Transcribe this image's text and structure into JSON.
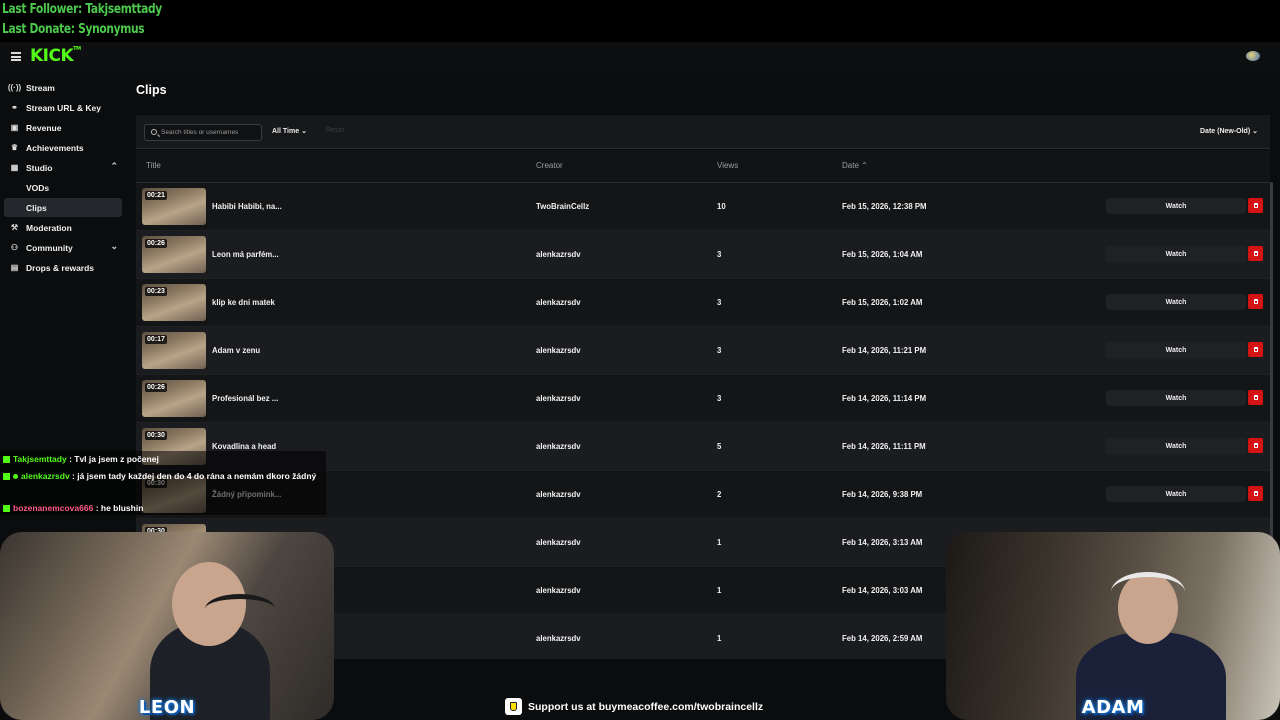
{
  "overlay": {
    "last_follower": "Last Follower: Takjsemttady",
    "last_donate": "Last Donate: Synonymus"
  },
  "header": {
    "logo": "KICK",
    "logo_tm": "TM"
  },
  "sidebar": {
    "items": [
      {
        "label": "Stream",
        "icon": "broadcast-icon"
      },
      {
        "label": "Stream URL & Key",
        "icon": "link-icon"
      },
      {
        "label": "Revenue",
        "icon": "wallet-icon"
      },
      {
        "label": "Achievements",
        "icon": "trophy-icon"
      },
      {
        "label": "Studio",
        "icon": "film-icon"
      },
      {
        "label": "VODs"
      },
      {
        "label": "Clips"
      },
      {
        "label": "Moderation",
        "icon": "hammer-icon"
      },
      {
        "label": "Community",
        "icon": "users-icon"
      },
      {
        "label": "Drops & rewards",
        "icon": "gift-icon"
      }
    ]
  },
  "page": {
    "title": "Clips"
  },
  "filters": {
    "search_placeholder": "Search titles or usernames",
    "time_range": "All Time",
    "reset": "Reset",
    "sort": "Date (New-Old)"
  },
  "table": {
    "columns": [
      "Title",
      "Creator",
      "Views",
      "Date"
    ],
    "watch_label": "Watch",
    "rows": [
      {
        "duration": "00:21",
        "title": "Habibi Habibi, na...",
        "creator": "TwoBrainCellz",
        "views": "10",
        "date": "Feb 15, 2026, 12:38 PM"
      },
      {
        "duration": "00:26",
        "title": "Leon má parfém...",
        "creator": "alenkazrsdv",
        "views": "3",
        "date": "Feb 15, 2026, 1:04 AM"
      },
      {
        "duration": "00:23",
        "title": "klip ke dni matek",
        "creator": "alenkazrsdv",
        "views": "3",
        "date": "Feb 15, 2026, 1:02 AM"
      },
      {
        "duration": "00:17",
        "title": "Adam v zenu",
        "creator": "alenkazrsdv",
        "views": "3",
        "date": "Feb 14, 2026, 11:21 PM"
      },
      {
        "duration": "00:26",
        "title": "Profesionál bez ...",
        "creator": "alenkazrsdv",
        "views": "3",
        "date": "Feb 14, 2026, 11:14 PM"
      },
      {
        "duration": "00:30",
        "title": "Kovadlina a head",
        "creator": "alenkazrsdv",
        "views": "5",
        "date": "Feb 14, 2026, 11:11 PM"
      },
      {
        "duration": "00:30",
        "title": "Žádný připomink...",
        "creator": "alenkazrsdv",
        "views": "2",
        "date": "Feb 14, 2026, 9:38 PM"
      },
      {
        "duration": "00:30",
        "title": "",
        "creator": "alenkazrsdv",
        "views": "1",
        "date": "Feb 14, 2026, 3:13 AM"
      },
      {
        "duration": "",
        "title": "",
        "creator": "alenkazrsdv",
        "views": "1",
        "date": "Feb 14, 2026, 3:03 AM"
      },
      {
        "duration": "",
        "title": "",
        "creator": "alenkazrsdv",
        "views": "1",
        "date": "Feb 14, 2026, 2:59 AM"
      }
    ]
  },
  "chat": [
    {
      "user": "Takjsemttady",
      "text": " : Tvl ja jsem z počenej"
    },
    {
      "user": "alenkazrsdv",
      "text": " : já jsem tady každej den do 4 do rána a nemám dkoro žádný"
    },
    {
      "user": "bozenanemcova666",
      "text": " : he blushin"
    }
  ],
  "cams": {
    "left_name": "LEON",
    "right_name": "ADAM"
  },
  "support": {
    "prefix": "Support us at ",
    "url": "buymeacoffee.com/twobraincellz"
  }
}
